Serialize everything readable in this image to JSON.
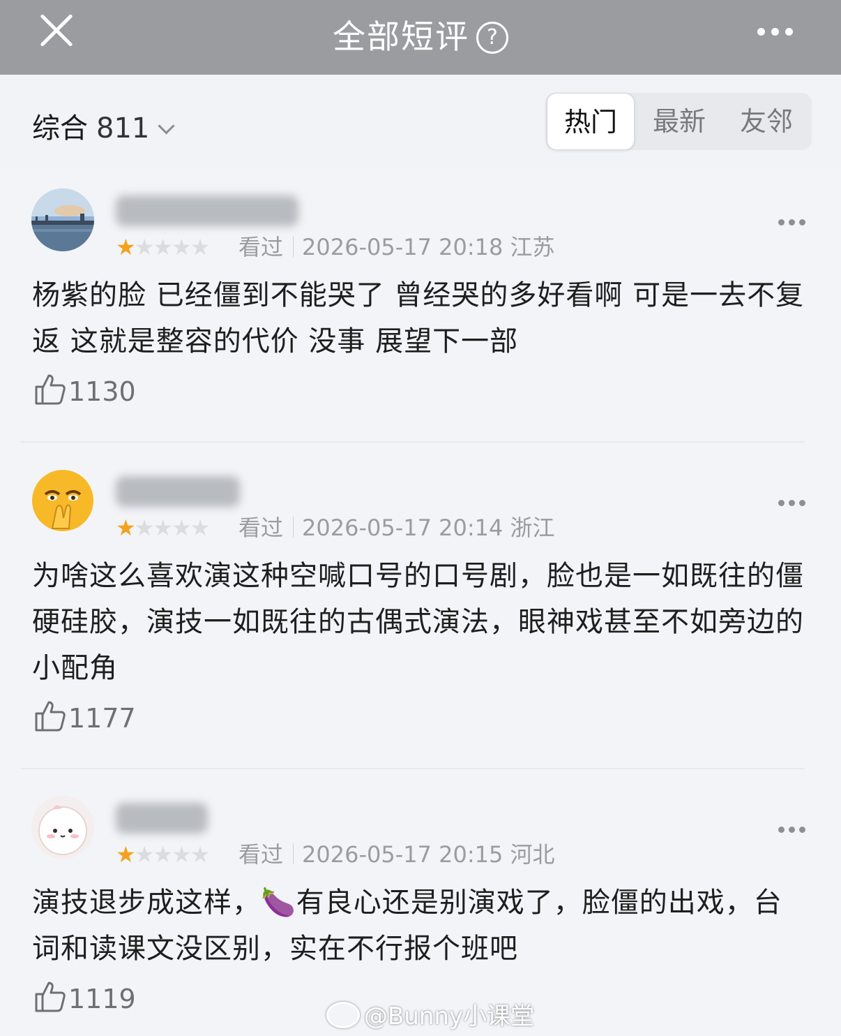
{
  "header": {
    "title": "全部短评",
    "help_icon": "?"
  },
  "filter": {
    "sort_label": "综合",
    "count": "811",
    "tabs": [
      {
        "label": "热门",
        "active": true
      },
      {
        "label": "最新",
        "active": false
      },
      {
        "label": "友邻",
        "active": false
      }
    ]
  },
  "reviews": [
    {
      "rating": 1,
      "max_rating": 5,
      "status": "看过",
      "datetime": "2026-05-17 20:18",
      "location": "江苏",
      "content": "杨紫的脸 已经僵到不能哭了 曾经哭的多好看啊 可是一去不复返 这就是整容的代价 没事 展望下一部",
      "likes": "1130"
    },
    {
      "rating": 1,
      "max_rating": 5,
      "status": "看过",
      "datetime": "2026-05-17 20:14",
      "location": "浙江",
      "content": "为啥这么喜欢演这种空喊口号的口号剧，脸也是一如既往的僵硬硅胶，演技一如既往的古偶式演法，眼神戏甚至不如旁边的小配角",
      "likes": "1177"
    },
    {
      "rating": 1,
      "max_rating": 5,
      "status": "看过",
      "datetime": "2026-05-17 20:15",
      "location": "河北",
      "content": "演技退步成这样，🍆有良心还是别演戏了，脸僵的出戏，台词和读课文没区别，实在不行报个班吧",
      "likes": "1119"
    }
  ],
  "watermark": "@Bunny小课堂",
  "colors": {
    "star": "#f4a21d",
    "topbar": "#9a9c9f",
    "background": "#f2f4f7"
  }
}
